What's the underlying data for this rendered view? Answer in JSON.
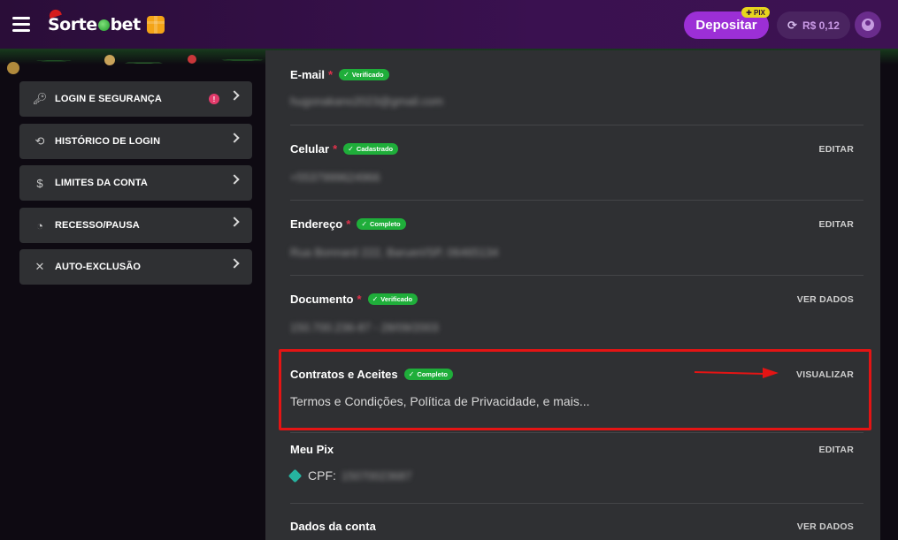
{
  "header": {
    "logo_text_a": "Sorte",
    "logo_text_b": "bet",
    "deposit_label": "Depositar",
    "pix_badge": "PIX",
    "balance": "R$ 0,12"
  },
  "sidebar": {
    "items": [
      {
        "label": "LOGIN E SEGURANÇA",
        "icon": "key-icon",
        "alert": "!"
      },
      {
        "label": "HISTÓRICO DE LOGIN",
        "icon": "history-icon"
      },
      {
        "label": "LIMITES DA CONTA",
        "icon": "money-bag-icon"
      },
      {
        "label": "RECESSO/PAUSA",
        "icon": "timer-icon"
      },
      {
        "label": "AUTO-EXCLUSÃO",
        "icon": "user-exclude-icon"
      }
    ]
  },
  "main": {
    "email": {
      "title": "E-mail",
      "required": "*",
      "badge": "Verificado",
      "value": "hugonakano2023@gmail.com"
    },
    "phone": {
      "title": "Celular",
      "required": "*",
      "badge": "Cadastrado",
      "action": "EDITAR",
      "value": "+5537999624966"
    },
    "address": {
      "title": "Endereço",
      "required": "*",
      "badge": "Completo",
      "action": "EDITAR",
      "value": "Rua Bonnard 222, Barueri/SP, 06465134"
    },
    "document": {
      "title": "Documento",
      "required": "*",
      "badge": "Verificado",
      "action": "VER DADOS",
      "value": "150.700.236-87 - 28/09/2003"
    },
    "contracts": {
      "title": "Contratos e Aceites",
      "badge": "Completo",
      "action": "VISUALIZAR",
      "value": "Termos e Condições, Política de Privacidade, e mais..."
    },
    "pix": {
      "title": "Meu Pix",
      "action": "EDITAR",
      "label": "CPF:",
      "value": "15070023687"
    },
    "account": {
      "title": "Dados da conta",
      "action": "VER DADOS"
    }
  },
  "colors": {
    "accent": "#9c2fd6",
    "badge_green": "#1fae3a",
    "highlight_red": "#e41414"
  }
}
